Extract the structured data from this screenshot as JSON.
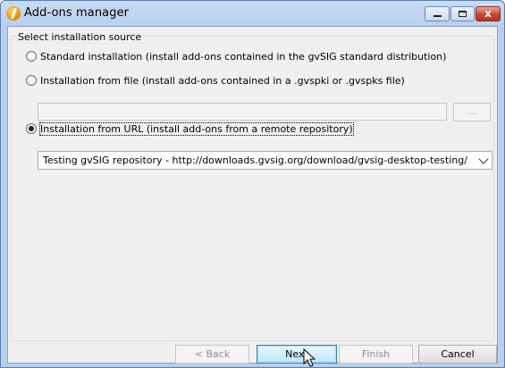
{
  "window": {
    "title": "Add-ons manager",
    "close_glyph": "x"
  },
  "group": {
    "legend": "Select installation source"
  },
  "options": {
    "standard": {
      "label": "Standard installation (install add-ons contained in the gvSIG standard distribution)",
      "selected": false
    },
    "file": {
      "label": "Installation from file (install add-ons contained in a .gvspki or .gvspks file)",
      "selected": false
    },
    "url": {
      "label": "Installation from URL (install add-ons from a remote repository)",
      "selected": true
    }
  },
  "file_path": {
    "value": "",
    "browse_label": "..."
  },
  "url_select": {
    "value": "Testing gvSIG repository - http://downloads.gvsig.org/download/gvsig-desktop-testing/"
  },
  "footer": {
    "back": "< Back",
    "next": "Next",
    "finish": "Finish",
    "cancel": "Cancel"
  }
}
